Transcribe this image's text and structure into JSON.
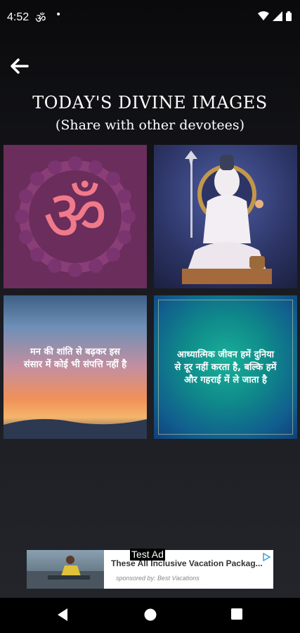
{
  "status_bar": {
    "time": "4:52",
    "om_glyph": "ॐ",
    "dot": "•"
  },
  "header": {
    "back_icon": "arrow-left-icon"
  },
  "title": "TODAY'S DIVINE IMAGES",
  "subtitle": "(Share with other devotees)",
  "tiles": [
    {
      "name": "om",
      "glyph": "ॐ"
    },
    {
      "name": "shiva"
    },
    {
      "name": "quote1",
      "text_line1": "मन की शांति से बढ़कर इस",
      "text_line2": "संसार में कोई भी संपत्ति नहीं है"
    },
    {
      "name": "quote2",
      "text_line1": "आध्यात्मिक जीवन हमें दुनिया",
      "text_line2": "से दूर नहीं करता है, बल्कि हमें",
      "text_line3": "और गहराई में ले जाता है"
    }
  ],
  "ad": {
    "test_label": "Test Ad",
    "headline": "These All Inclusive Vacation Packag...",
    "sponsor": "sponsored by: Best Vacations",
    "ad_choices_icon": "ad-choices-icon"
  },
  "nav": {
    "back": "nav-back-icon",
    "home": "nav-home-icon",
    "recents": "nav-recents-icon"
  },
  "colors": {
    "om_tile": "#6b2d5b",
    "om_glyph": "#f07a8a",
    "quote2_tile": "#0f8a8a"
  }
}
